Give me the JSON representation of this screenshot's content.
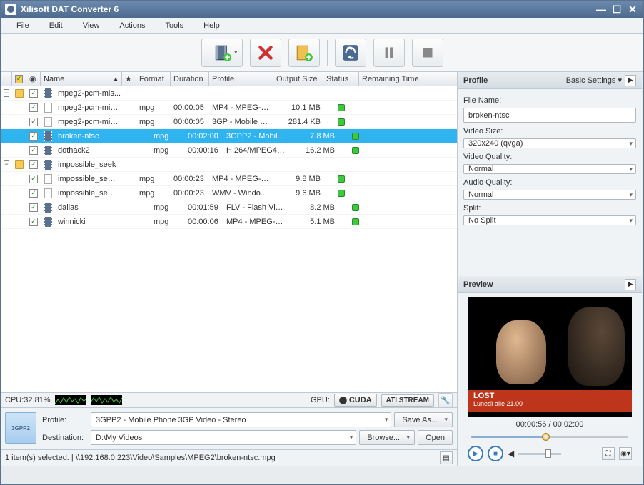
{
  "window": {
    "title": "Xilisoft DAT Converter 6"
  },
  "menu": {
    "file": "File",
    "edit": "Edit",
    "view": "View",
    "actions": "Actions",
    "tools": "Tools",
    "help": "Help"
  },
  "columns": {
    "name": "Name",
    "format": "Format",
    "duration": "Duration",
    "profile": "Profile",
    "output": "Output Size",
    "status": "Status",
    "remaining": "Remaining Time"
  },
  "rows": [
    {
      "level": 0,
      "exp": "−",
      "folder": true,
      "chk": true,
      "film": true,
      "name": "mpeg2-pcm-mis...",
      "fmt": "",
      "dur": "",
      "prof": "",
      "out": "",
      "dot": false
    },
    {
      "level": 1,
      "chk": true,
      "doc": true,
      "name": "mpeg2-pcm-mis...",
      "fmt": "mpg",
      "dur": "00:00:05",
      "prof": "MP4 - MPEG-4 ...",
      "out": "10.1 MB",
      "dot": true
    },
    {
      "level": 1,
      "chk": true,
      "doc": true,
      "name": "mpeg2-pcm-mis...",
      "fmt": "mpg",
      "dur": "00:00:05",
      "prof": "3GP - Mobile P...",
      "out": "281.4 KB",
      "dot": true
    },
    {
      "level": 0,
      "sel": true,
      "chk": true,
      "film": true,
      "name": "broken-ntsc",
      "fmt": "mpg",
      "dur": "00:02:00",
      "prof": "3GPP2 - Mobil...",
      "out": "7.8 MB",
      "dot": true
    },
    {
      "level": 0,
      "chk": true,
      "film": true,
      "name": "dothack2",
      "fmt": "mpg",
      "dur": "00:00:16",
      "prof": "H.264/MPEG4 ...",
      "out": "16.2 MB",
      "dot": true
    },
    {
      "level": 0,
      "exp": "−",
      "folder": true,
      "chk": true,
      "film": true,
      "name": "impossible_seek",
      "fmt": "",
      "dur": "",
      "prof": "",
      "out": "",
      "dot": false
    },
    {
      "level": 1,
      "chk": true,
      "doc": true,
      "name": "impossible_seek...",
      "fmt": "mpg",
      "dur": "00:00:23",
      "prof": "MP4 - MPEG-4 ...",
      "out": "9.8 MB",
      "dot": true
    },
    {
      "level": 1,
      "chk": true,
      "doc": true,
      "name": "impossible_seek...",
      "fmt": "mpg",
      "dur": "00:00:23",
      "prof": "WMV - Windo...",
      "out": "9.6 MB",
      "dot": true
    },
    {
      "level": 0,
      "chk": true,
      "film": true,
      "name": "dallas",
      "fmt": "mpg",
      "dur": "00:01:59",
      "prof": "FLV - Flash Vid...",
      "out": "8.2 MB",
      "dot": true
    },
    {
      "level": 0,
      "chk": true,
      "film": true,
      "name": "winnicki",
      "fmt": "mpg",
      "dur": "00:00:06",
      "prof": "MP4 - MPEG-4 ...",
      "out": "5.1 MB",
      "dot": true
    }
  ],
  "cpu": {
    "label": "CPU:32.81%"
  },
  "gpu": {
    "label": "GPU:",
    "cuda": "CUDA",
    "ati": "ATI STREAM"
  },
  "bottom": {
    "icon": "3GPP2",
    "profile_label": "Profile:",
    "profile_value": "3GPP2 - Mobile Phone 3GP Video - Stereo",
    "saveas": "Save As...",
    "dest_label": "Destination:",
    "dest_value": "D:\\My Videos",
    "browse": "Browse...",
    "open": "Open"
  },
  "statusbar": "1 item(s) selected. | \\\\192.168.0.223\\Video\\Samples\\MPEG2\\broken-ntsc.mpg",
  "profile_panel": {
    "title": "Profile",
    "basic": "Basic Settings ▾",
    "filename_l": "File Name:",
    "filename_v": "broken-ntsc",
    "videosize_l": "Video Size:",
    "videosize_v": "320x240 (qvga)",
    "videoq_l": "Video Quality:",
    "videoq_v": "Normal",
    "audioq_l": "Audio Quality:",
    "audioq_v": "Normal",
    "split_l": "Split:",
    "split_v": "No Split"
  },
  "preview": {
    "title": "Preview",
    "banner_title": "LOST",
    "banner_sub": "Lunedì alle 21.00",
    "time": "00:00:56 / 00:02:00",
    "progress": 47
  }
}
